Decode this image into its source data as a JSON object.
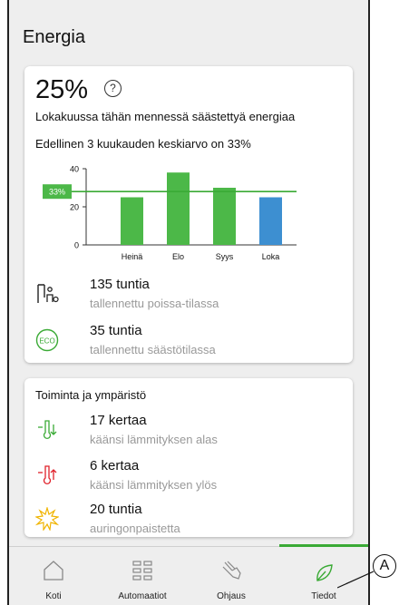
{
  "header": {
    "title": "Energia"
  },
  "summary": {
    "percent": "25%",
    "help_glyph": "?",
    "description": "Lokakuussa tähän mennessä säästettyä energiaa",
    "average_text": "Edellinen 3 kuukauden keskiarvo on 33%"
  },
  "chart_data": {
    "type": "bar",
    "categories": [
      "Heinä",
      "Elo",
      "Syys",
      "Loka"
    ],
    "values": [
      25,
      38,
      30,
      25
    ],
    "ylim": [
      0,
      40
    ],
    "yticks": [
      "0",
      "20",
      "40"
    ],
    "reference_line": {
      "value": 28,
      "label": "33%"
    },
    "colors": [
      "#4cb848",
      "#4cb848",
      "#4cb848",
      "#3d8fd1"
    ],
    "grid": false
  },
  "stats": [
    {
      "icon": "away-mode-icon",
      "value": "135 tuntia",
      "label": "tallennettu poissa-tilassa"
    },
    {
      "icon": "eco-icon",
      "value": "35 tuntia",
      "label": "tallennettu säästötilassa"
    }
  ],
  "activity": {
    "title": "Toiminta ja ympäristö",
    "items": [
      {
        "icon": "thermometer-down-icon",
        "value": "17 kertaa",
        "label": "käänsi lämmityksen alas"
      },
      {
        "icon": "thermometer-up-icon",
        "value": "6 kertaa",
        "label": "käänsi lämmityksen ylös"
      },
      {
        "icon": "sun-icon",
        "value": "20 tuntia",
        "label": "auringonpaistetta"
      }
    ]
  },
  "nav": [
    {
      "label": "Koti",
      "icon": "home-icon"
    },
    {
      "label": "Automaatiot",
      "icon": "grid-icon"
    },
    {
      "label": "Ohjaus",
      "icon": "hand-icon"
    },
    {
      "label": "Tiedot",
      "icon": "leaf-icon",
      "active": true
    }
  ],
  "callout": {
    "label": "A"
  },
  "colors": {
    "accent": "#3aaa35",
    "bar_green": "#4cb848",
    "bar_blue": "#3d8fd1",
    "thermo_down": "#3aaa35",
    "thermo_up": "#e0202a",
    "sun": "#f0b400"
  }
}
